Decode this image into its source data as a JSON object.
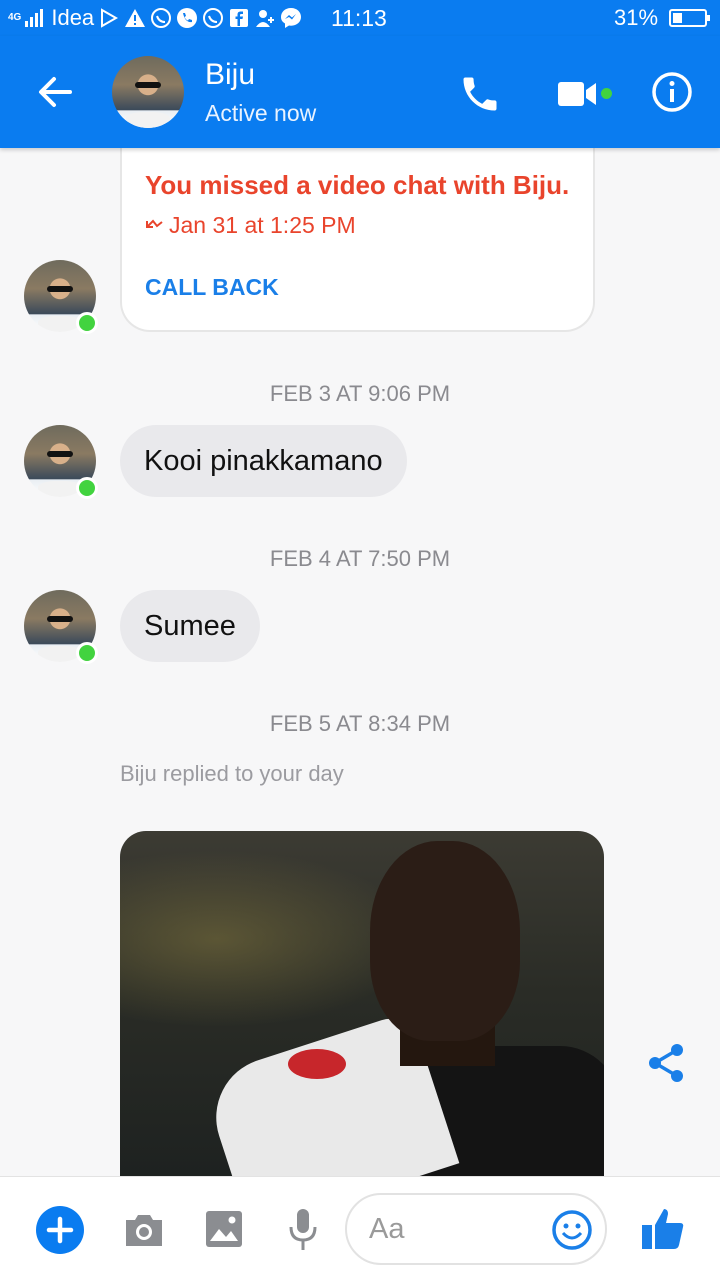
{
  "status_bar": {
    "network": "4G",
    "carrier": "Idea",
    "time": "11:13",
    "battery": "31%",
    "battery_level": 0.31
  },
  "header": {
    "contact_name": "Biju",
    "contact_status": "Active now",
    "icons": [
      "back-arrow-icon",
      "phone-icon",
      "video-camera-icon",
      "info-icon"
    ]
  },
  "messages": {
    "missed_call": {
      "title": "You missed a video chat with Biju.",
      "time": "Jan 31 at 1:25 PM",
      "action": "CALL BACK"
    },
    "groups": [
      {
        "timestamp": "FEB 3 AT 9:06 PM",
        "text": "Kooi pinakkamano"
      },
      {
        "timestamp": "FEB 4 AT 7:50 PM",
        "text": "Sumee"
      }
    ],
    "story_reply": {
      "timestamp": "FEB 5 AT 8:34 PM",
      "note": "Biju replied to your day"
    }
  },
  "composer": {
    "placeholder": "Aa",
    "icons": [
      "plus-icon",
      "camera-icon",
      "gallery-icon",
      "microphone-icon",
      "emoji-icon",
      "thumbs-up-icon"
    ]
  },
  "colors": {
    "brand": "#0a7cf0",
    "missed": "#e9442c",
    "online": "#42d33f"
  }
}
